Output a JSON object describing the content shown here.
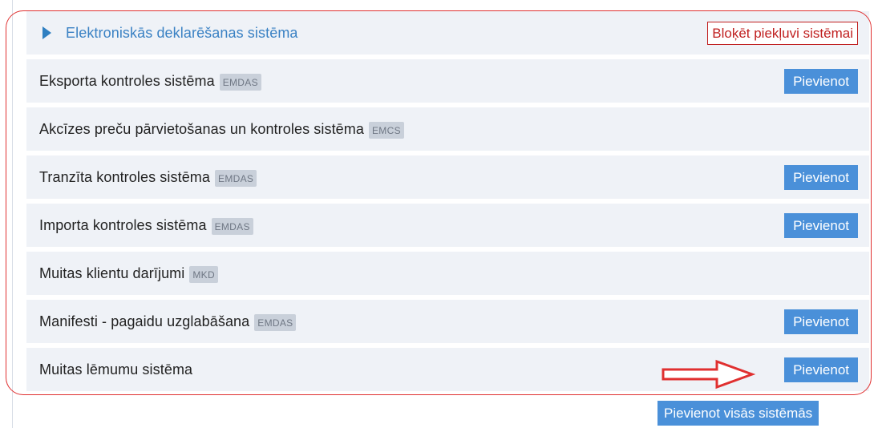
{
  "header": {
    "title": "Elektroniskās deklarēšanas sistēma",
    "block_access": "Bloķēt piekļuvi sistēmai"
  },
  "systems": [
    {
      "name": "Eksporta kontroles sistēma",
      "badge": "EMDAS",
      "action": "Pievienot"
    },
    {
      "name": "Akcīzes preču pārvietošanas un kontroles sistēma",
      "badge": "EMCS",
      "action": ""
    },
    {
      "name": "Tranzīta kontroles sistēma",
      "badge": "EMDAS",
      "action": "Pievienot"
    },
    {
      "name": "Importa kontroles sistēma",
      "badge": "EMDAS",
      "action": "Pievienot"
    },
    {
      "name": "Muitas klientu darījumi",
      "badge": "MKD",
      "action": ""
    },
    {
      "name": "Manifesti - pagaidu uzglabāšana",
      "badge": "EMDAS",
      "action": "Pievienot"
    },
    {
      "name": "Muitas lēmumu sistēma",
      "badge": "",
      "action": "Pievienot"
    }
  ],
  "footer": {
    "add_all": "Pievienot visās sistēmās"
  },
  "colors": {
    "accent": "#4a90d9",
    "row_bg": "#eff2f7",
    "annotation": "#e03030",
    "header_text": "#3b82c4"
  }
}
